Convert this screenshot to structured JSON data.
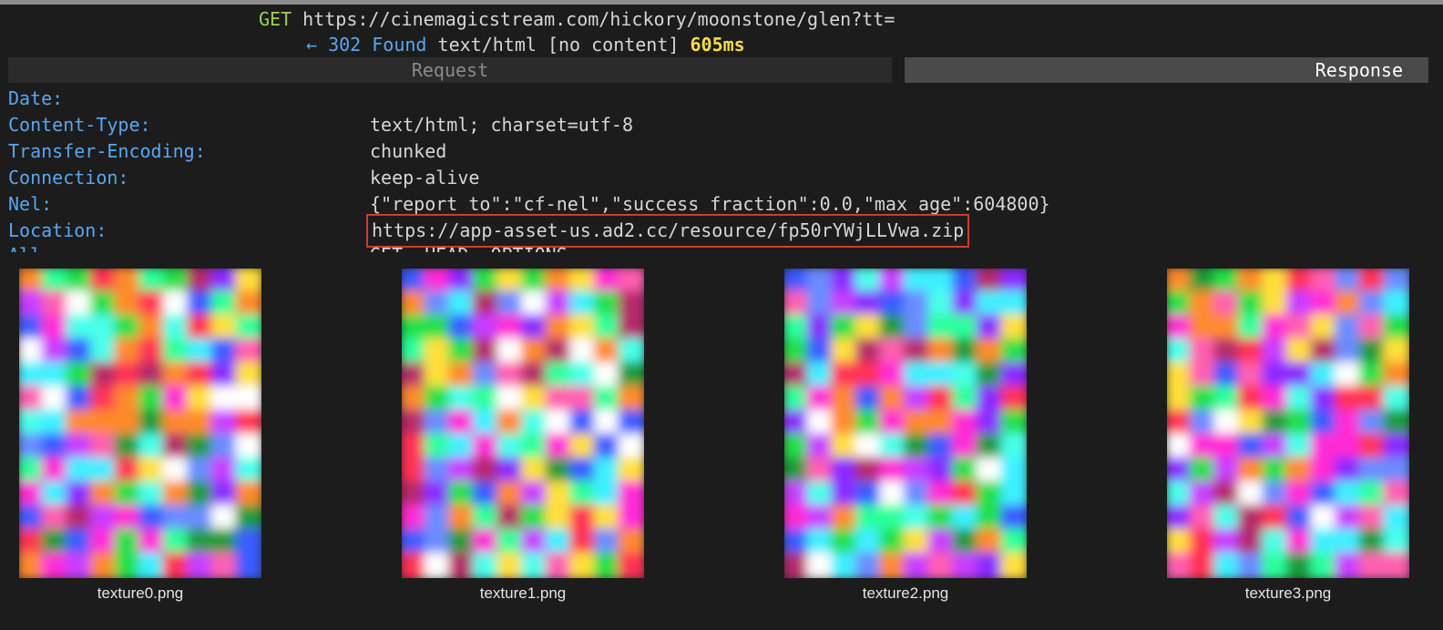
{
  "request_line": {
    "method": "GET",
    "url": "https://cinemagicstream.com/hickory/moonstone/glen?tt="
  },
  "response_line": {
    "arrow": "←",
    "status_code": "302",
    "status_text": "Found",
    "content_info": "text/html [no content]",
    "duration": "605ms"
  },
  "tabs": {
    "request": "Request",
    "response": "Response"
  },
  "headers": [
    {
      "key": "Date:",
      "value": ""
    },
    {
      "key": "Content-Type:",
      "value": "text/html; charset=utf-8"
    },
    {
      "key": "Transfer-Encoding:",
      "value": "chunked"
    },
    {
      "key": "Connection:",
      "value": "keep-alive"
    },
    {
      "key": "Nel:",
      "value": "{\"report_to\":\"cf-nel\",\"success_fraction\":0.0,\"max_age\":604800}"
    },
    {
      "key": "Location:",
      "value": "https://app-asset-us.ad2.cc/resource/fp50rYWjLLVwa.zip"
    },
    {
      "key": "All",
      "value": "GET, HEAD, OPTIONS"
    }
  ],
  "images": [
    {
      "filename": "texture0.png"
    },
    {
      "filename": "texture1.png"
    },
    {
      "filename": "texture2.png"
    },
    {
      "filename": "texture3.png"
    }
  ],
  "colors": {
    "background": "#1c1c1c",
    "method": "#9bcf5b",
    "header_key": "#5aa6f0",
    "duration": "#f5dd45",
    "highlight_border": "#d33a2c"
  }
}
